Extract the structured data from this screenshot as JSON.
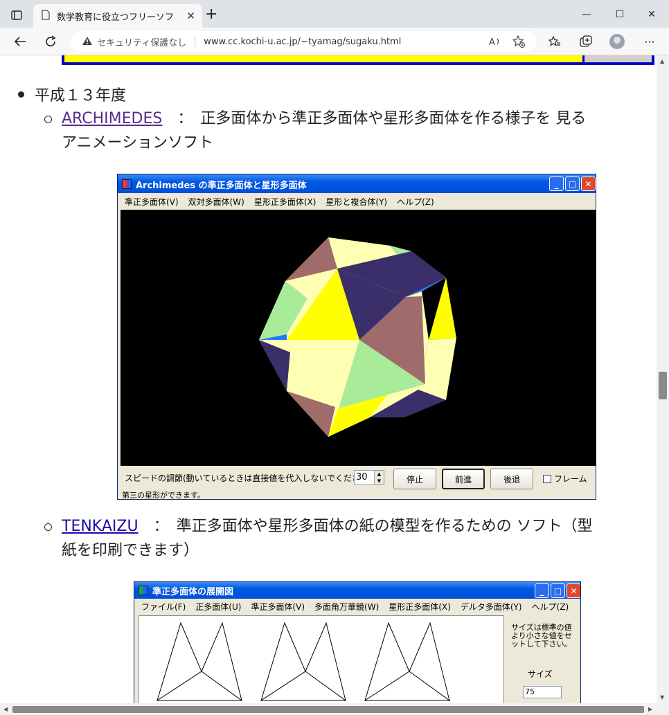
{
  "browser": {
    "tab_title": "数学教育に役立つフリーソフト達",
    "tab_close": "✕",
    "new_tab": "+",
    "security_label": "セキュリティ保護なし",
    "url": "www.cc.kochi-u.ac.jp/~tyamag/sugaku.html",
    "minimize": "—",
    "maximize": "☐",
    "close": "✕"
  },
  "page": {
    "year_heading": "平成１３年度",
    "item1": {
      "link": "ARCHIMEDES",
      "desc_line1": "　：　正多面体から準正多面体や星形多面体を作る様子を 見る",
      "desc_line2": "アニメーションソフト"
    },
    "item2": {
      "link": "TENKAIZU",
      "desc_line1": "　：　準正多面体や星形多面体の紙の模型を作るための ソフト（型",
      "desc_line2": "紙を印刷できます）"
    }
  },
  "archimedes": {
    "title": "Archimedes の準正多面体と星形多面体",
    "menu": [
      "準正多面体(V)",
      "双対多面体(W)",
      "星形正多面体(X)",
      "星形と複合体(Y)",
      "ヘルプ(Z)"
    ],
    "speed_label": "スピードの調節(動いているときは直接値を代入しないでください)",
    "speed_value": "30",
    "stop": "停止",
    "forward": "前進",
    "back": "後退",
    "frame_label": "フレーム",
    "status": "第三の星形ができます。",
    "btn_min": "_",
    "btn_max": "□",
    "btn_close": "✕"
  },
  "tenkaizu": {
    "title": "準正多面体の展開図",
    "menu": [
      "ファイル(F)",
      "正多面体(U)",
      "準正多面体(V)",
      "多面角万華鏡(W)",
      "星形正多面体(X)",
      "デルタ多面体(Y)",
      "ヘルプ(Z)"
    ],
    "side_text": "サイズは標準の値より小さな値をセットして下さい。",
    "size_label": "サイズ",
    "size_value": "75",
    "btn_min": "_",
    "btn_max": "□",
    "btn_close": "✕"
  },
  "colors": {
    "link_visited": "#5a2a8c",
    "link": "#1a0dab",
    "xp_title_blue": "#0058e3",
    "xp_close": "#e0482a"
  }
}
